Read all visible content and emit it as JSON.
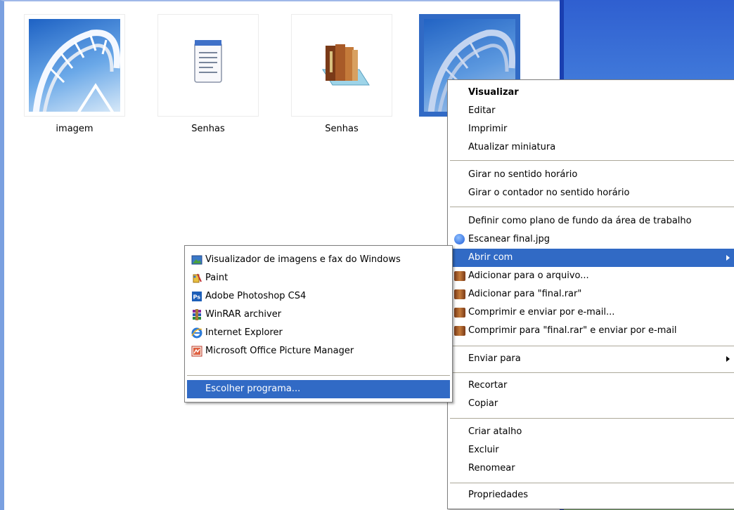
{
  "files": [
    {
      "label": "imagem",
      "icon": "photo-icon"
    },
    {
      "label": "Senhas",
      "icon": "notepad-icon"
    },
    {
      "label": "Senhas",
      "icon": "books-icon"
    },
    {
      "label": "",
      "icon": "photo-icon",
      "selected": true
    }
  ],
  "context_menu": {
    "items": [
      {
        "label": "Visualizar",
        "bold": true
      },
      {
        "label": "Editar"
      },
      {
        "label": "Imprimir"
      },
      {
        "label": "Atualizar miniatura"
      },
      {
        "label": "Girar no sentido horário"
      },
      {
        "label": "Girar o contador no sentido horário"
      },
      {
        "label": "Definir como plano de fundo da área de trabalho"
      },
      {
        "label": "Escanear final.jpg",
        "icon": "antivirus-icon"
      },
      {
        "label": "Abrir com",
        "submenu": true,
        "highlighted": true
      },
      {
        "label": "Adicionar para o arquivo...",
        "icon": "winrar-icon"
      },
      {
        "label": "Adicionar para \"final.rar\"",
        "icon": "winrar-icon"
      },
      {
        "label": "Comprimir e enviar por e-mail...",
        "icon": "winrar-icon"
      },
      {
        "label": "Comprimir para \"final.rar\" e enviar por e-mail",
        "icon": "winrar-icon"
      },
      {
        "label": "Enviar para",
        "submenu": true
      },
      {
        "label": "Recortar"
      },
      {
        "label": "Copiar"
      },
      {
        "label": "Criar atalho"
      },
      {
        "label": "Excluir"
      },
      {
        "label": "Renomear"
      },
      {
        "label": "Propriedades"
      }
    ]
  },
  "open_with_submenu": {
    "items": [
      {
        "label": "Visualizador de imagens e fax do Windows",
        "icon": "image-viewer-icon"
      },
      {
        "label": "Paint",
        "icon": "paint-icon"
      },
      {
        "label": "Adobe Photoshop CS4",
        "icon": "photoshop-icon"
      },
      {
        "label": "WinRAR archiver",
        "icon": "winrar-icon"
      },
      {
        "label": "Internet Explorer",
        "icon": "internet-explorer-icon"
      },
      {
        "label": "Microsoft Office Picture Manager",
        "icon": "picture-manager-icon"
      },
      {
        "label": "Escolher programa...",
        "highlighted": true
      }
    ]
  },
  "colors": {
    "highlight": "#316ac5",
    "menu_border": "#7f7f7f",
    "separator": "#aca899"
  }
}
